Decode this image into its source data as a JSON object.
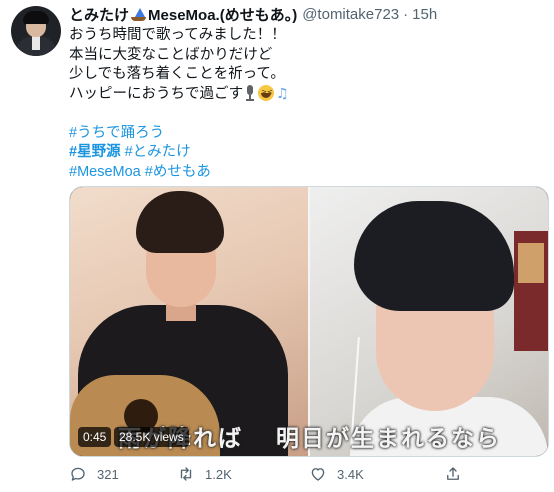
{
  "tweet": {
    "author_name": "とみたけ",
    "author_name_suffix": "MeseMoa.(めせもあ。)",
    "handle": "@tomitake723",
    "separator": "·",
    "timestamp": "15h",
    "lines": [
      "おうち時間で歌ってみました！！",
      "本当に大変なことばかりだけど",
      "少しでも落ち着くことを祈って。",
      "ハッピーにおうちで過ごす"
    ],
    "hashtags": {
      "uchi_de_odorou": "#うちで踊ろう",
      "hoshino_gen": "#星野源",
      "tomitake": "#とみたけ",
      "mesemoa": "#MeseMoa",
      "mesemoa_kana": "#めせもあ"
    }
  },
  "video": {
    "duration": "0:45",
    "views": "28.5K views",
    "subtitle_left": "雨が降れば",
    "subtitle_right": "明日が生まれるなら"
  },
  "actions": {
    "replies": "321",
    "retweets": "1.2K",
    "likes": "3.4K"
  },
  "colors": {
    "link": "#1b95e0",
    "muted": "#536471",
    "text": "#0f1419"
  },
  "icons": [
    "avatar",
    "sailboat-emoji-icon",
    "microphone-emoji-icon",
    "grinning-emoji-icon",
    "music-notes-emoji-icon",
    "reply-icon",
    "retweet-icon",
    "like-icon",
    "share-icon"
  ]
}
